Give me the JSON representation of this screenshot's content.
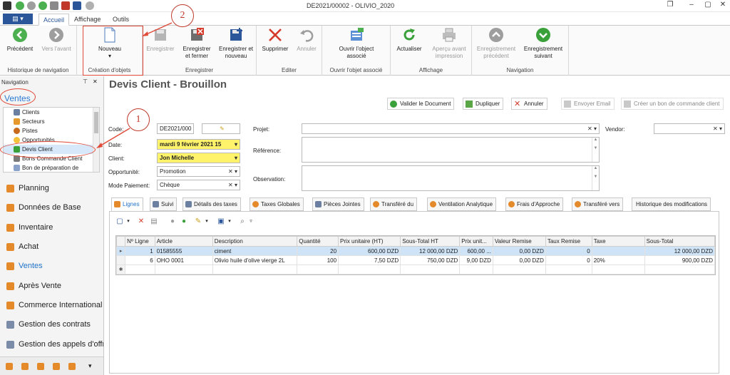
{
  "window": {
    "title": "DE2021/00002 - OLIVIO_2020"
  },
  "ribbon_tabs": [
    "Accueil",
    "Affichage",
    "Outils"
  ],
  "ribbon": {
    "groups": [
      {
        "label": "Historique de navigation",
        "buttons": [
          {
            "label": "Précédent",
            "disabled": false
          },
          {
            "label": "Vers l'avant",
            "disabled": true
          }
        ]
      },
      {
        "label": "Création d'objets",
        "buttons": [
          {
            "label": "Nouveau",
            "disabled": false
          }
        ]
      },
      {
        "label": "Enregistrer",
        "buttons": [
          {
            "label": "Enregistrer",
            "disabled": true
          },
          {
            "label": "Enregistrer et fermer",
            "disabled": false
          },
          {
            "label": "Enregistrer et nouveau",
            "disabled": false
          }
        ]
      },
      {
        "label": "Editer",
        "buttons": [
          {
            "label": "Supprimer",
            "disabled": false
          },
          {
            "label": "Annuler",
            "disabled": true
          }
        ]
      },
      {
        "label": "Ouvrir l'objet associé",
        "buttons": [
          {
            "label": "Ouvrir l'object associé",
            "disabled": false
          }
        ]
      },
      {
        "label": "Affichage",
        "buttons": [
          {
            "label": "Actualiser",
            "disabled": false
          },
          {
            "label": "Aperçu avant impression",
            "disabled": true
          }
        ]
      },
      {
        "label": "Navigation",
        "buttons": [
          {
            "label": "Enregistrement précédent",
            "disabled": true
          },
          {
            "label": "Enregistrement suivant",
            "disabled": false
          }
        ]
      }
    ]
  },
  "nav": {
    "header": "Navigation",
    "section": "Ventes",
    "tree": [
      "Clients",
      "Secteurs",
      "Pistes",
      "Opportunités",
      "Devis Client",
      "Bons Commande Client",
      "Bon de préparation de"
    ],
    "selected_tree_item": "Devis Client",
    "modules": [
      "Planning",
      "Données de Base",
      "Inventaire",
      "Achat",
      "Ventes",
      "Après Vente",
      "Commerce International",
      "Gestion des contrats",
      "Gestion des appels d'offr"
    ],
    "active_module": "Ventes"
  },
  "page": {
    "title": "Devis Client - Brouillon",
    "actions": [
      {
        "label": "Valider le Document",
        "disabled": false
      },
      {
        "label": "Dupliquer",
        "disabled": false
      },
      {
        "label": "Annuler",
        "disabled": false
      },
      {
        "label": "Envoyer Email",
        "disabled": true
      },
      {
        "label": "Créer un bon de commande client",
        "disabled": true
      }
    ]
  },
  "form": {
    "code": {
      "label": "Code:",
      "value": "DE2021/000"
    },
    "date": {
      "label": "Date:",
      "value": "mardi 9 février 2021 15"
    },
    "client": {
      "label": "Client:",
      "value": "Jon Michelle"
    },
    "opportunite": {
      "label": "Opportunité:",
      "value": "Promotion"
    },
    "mode_paiement": {
      "label": "Mode Paiement:",
      "value": "Chèque"
    },
    "projet": {
      "label": "Projet:",
      "value": ""
    },
    "reference": {
      "label": "Référence:",
      "value": ""
    },
    "observation": {
      "label": "Observation:",
      "value": ""
    },
    "vendor": {
      "label": "Vendor:",
      "value": ""
    }
  },
  "detail_tabs": [
    "Lignes",
    "Suivi",
    "Détails des taxes",
    "Taxes Globales",
    "Pièces Jointes",
    "Transféré du",
    "Ventilation Analytique",
    "Frais d'Approche",
    "Transféré vers",
    "Historique des modifications"
  ],
  "grid": {
    "columns": [
      "Nº Ligne",
      "Article",
      "Description",
      "Quantité",
      "Prix unitaire (HT)",
      "Sous-Total HT",
      "Prix unit...",
      "Valeur Remise",
      "Taux Remise",
      "Taxe",
      "Sous-Total"
    ],
    "rows": [
      [
        "1",
        "01585555",
        "ciment",
        "20",
        "600,00 DZD",
        "12 000,00 DZD",
        "600,00 ...",
        "0,00 DZD",
        "0",
        "",
        "12 000,00 DZD"
      ],
      [
        "6",
        "OHO 0001",
        "Olivio huile d'olive vierge 2L",
        "100",
        "7,50 DZD",
        "750,00 DZD",
        "9,00 DZD",
        "0,00 DZD",
        "0",
        "20%",
        "900,00 DZD"
      ]
    ]
  },
  "annotations": {
    "callout_1": "1",
    "callout_2": "2"
  },
  "colors": {
    "accent": "#2b579a",
    "selection": "#cfe3f7",
    "highlight_field": "#fff36b",
    "annotation": "#e04b3a"
  }
}
